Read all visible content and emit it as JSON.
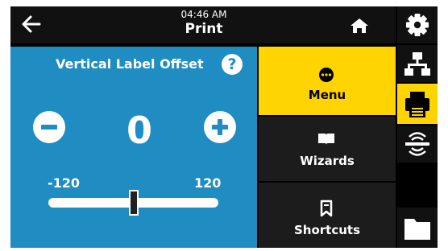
{
  "header": {
    "time": "04:46 AM",
    "title": "Print"
  },
  "panel": {
    "title": "Vertical Label Offset",
    "help_glyph": "?",
    "value": "0",
    "min_label": "-120",
    "max_label": "120",
    "slider": {
      "min": -120,
      "max": 120,
      "value": 0
    }
  },
  "menu": [
    {
      "label": "Menu",
      "icon": "dots-menu-icon",
      "active": true
    },
    {
      "label": "Wizards",
      "icon": "book-icon",
      "active": false
    },
    {
      "label": "Shortcuts",
      "icon": "bookmark-icon",
      "active": false
    }
  ],
  "rail": [
    {
      "icon": "gear-icon",
      "active": false
    },
    {
      "icon": "network-icon",
      "active": false
    },
    {
      "icon": "printer-icon",
      "active": true
    },
    {
      "icon": "rfid-icon",
      "active": false
    },
    {
      "icon": "folder-icon",
      "active": false
    }
  ],
  "colors": {
    "accent": "#ffd400",
    "panel": "#1f8cc2",
    "dark": "#1c1c1c",
    "black": "#000000"
  }
}
